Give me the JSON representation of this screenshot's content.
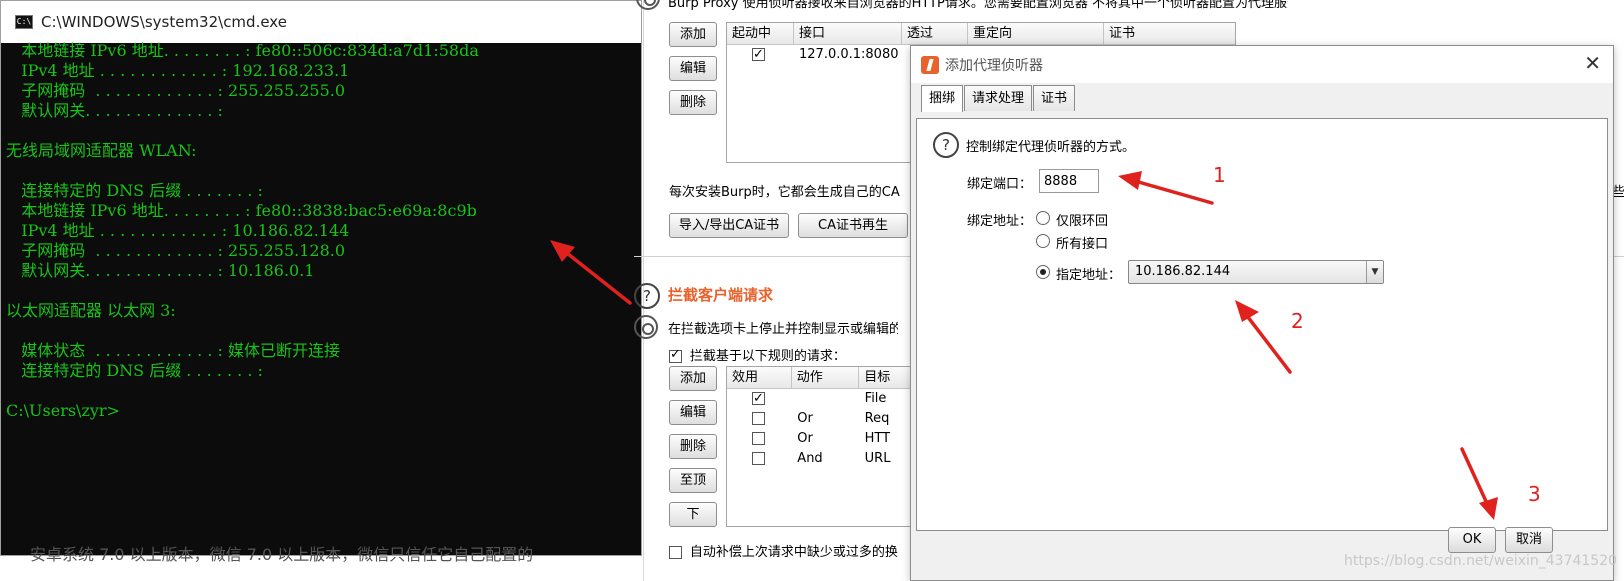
{
  "cmd": {
    "title": "C:\\WINDOWS\\system32\\cmd.exe",
    "icon_text": "C:\\",
    "lines": [
      "   本地链接 IPv6 地址. . . . . . . . : fe80::506c:834d:a7d1:58da",
      "   IPv4 地址 . . . . . . . . . . . . : 192.168.233.1",
      "   子网掩码  . . . . . . . . . . . . : 255.255.255.0",
      "   默认网关. . . . . . . . . . . . . :",
      "",
      "无线局域网适配器 WLAN:",
      "",
      "   连接特定的 DNS 后缀 . . . . . . . :",
      "   本地链接 IPv6 地址. . . . . . . . : fe80::3838:bac5:e69a:8c9b",
      "   IPv4 地址 . . . . . . . . . . . . : 10.186.82.144",
      "   子网掩码  . . . . . . . . . . . . : 255.255.128.0",
      "   默认网关. . . . . . . . . . . . . : 10.186.0.1",
      "",
      "以太网适配器 以太网 3:",
      "",
      "   媒体状态  . . . . . . . . . . . . : 媒体已断开连接",
      "   连接特定的 DNS 后缀 . . . . . . . :",
      "",
      "C:\\Users\\zyr>"
    ]
  },
  "page_bottom_text": "安卓系统 7.0 以上版本，微信 7.0 以上版本，微信只信任它自己配置的",
  "burp": {
    "top_text": "Burp Proxy 使用侦听器接收来自浏览器的HTTP请求。您需要配置浏览器 不将其中一个侦听器配置为代理服务器",
    "listener_buttons": {
      "add": "添加",
      "edit": "编辑",
      "remove": "删除"
    },
    "listener_table": {
      "headers": [
        "起动中",
        "接口",
        "透过",
        "重定向",
        "证书"
      ],
      "row": {
        "running": true,
        "interface": "127.0.0.1:8080"
      }
    },
    "ca_text": "每次安装Burp时，它都会生成自己的CA",
    "ca_text_tail": "些",
    "ca_buttons": {
      "import_export": "导入/导出CA证书",
      "regenerate": "CA证书再生"
    },
    "intercept": {
      "title": "拦截客户端请求",
      "desc": "在拦截选项卡上停止并控制显示或编辑的",
      "rule_checkbox_label": "拦截基于以下规则的请求：",
      "rule_checkbox_checked": true,
      "buttons": {
        "add": "添加",
        "edit": "编辑",
        "remove": "删除",
        "up": "至顶",
        "down": "下"
      },
      "headers": [
        "效用",
        "动作",
        "目标"
      ],
      "rows": [
        {
          "enabled": true,
          "op": "",
          "target": "File"
        },
        {
          "enabled": false,
          "op": "Or",
          "target": "Req"
        },
        {
          "enabled": false,
          "op": "Or",
          "target": "HTT"
        },
        {
          "enabled": false,
          "op": "And",
          "target": "URL"
        }
      ],
      "auto_fix_label": "自动补偿上次请求中缺少或过多的换"
    }
  },
  "dialog": {
    "title": "添加代理侦听器",
    "close_glyph": "✕",
    "tabs": [
      "捆绑",
      "请求处理",
      "证书"
    ],
    "active_tab": 0,
    "description": "控制绑定代理侦听器的方式。",
    "port_label": "绑定端口：",
    "port_value": "8888",
    "address_label": "绑定地址：",
    "address_options": [
      "仅限环回",
      "所有接口",
      "指定地址："
    ],
    "selected_address_option": 2,
    "address_value": "10.186.82.144",
    "dropdown_glyph": "▼",
    "ok_label": "OK",
    "cancel_label": "取消"
  },
  "annotations": {
    "one": "1",
    "two": "2",
    "three": "3",
    "color": "#e0221f"
  },
  "watermark": "https://blog.csdn.net/weixin_43741520"
}
